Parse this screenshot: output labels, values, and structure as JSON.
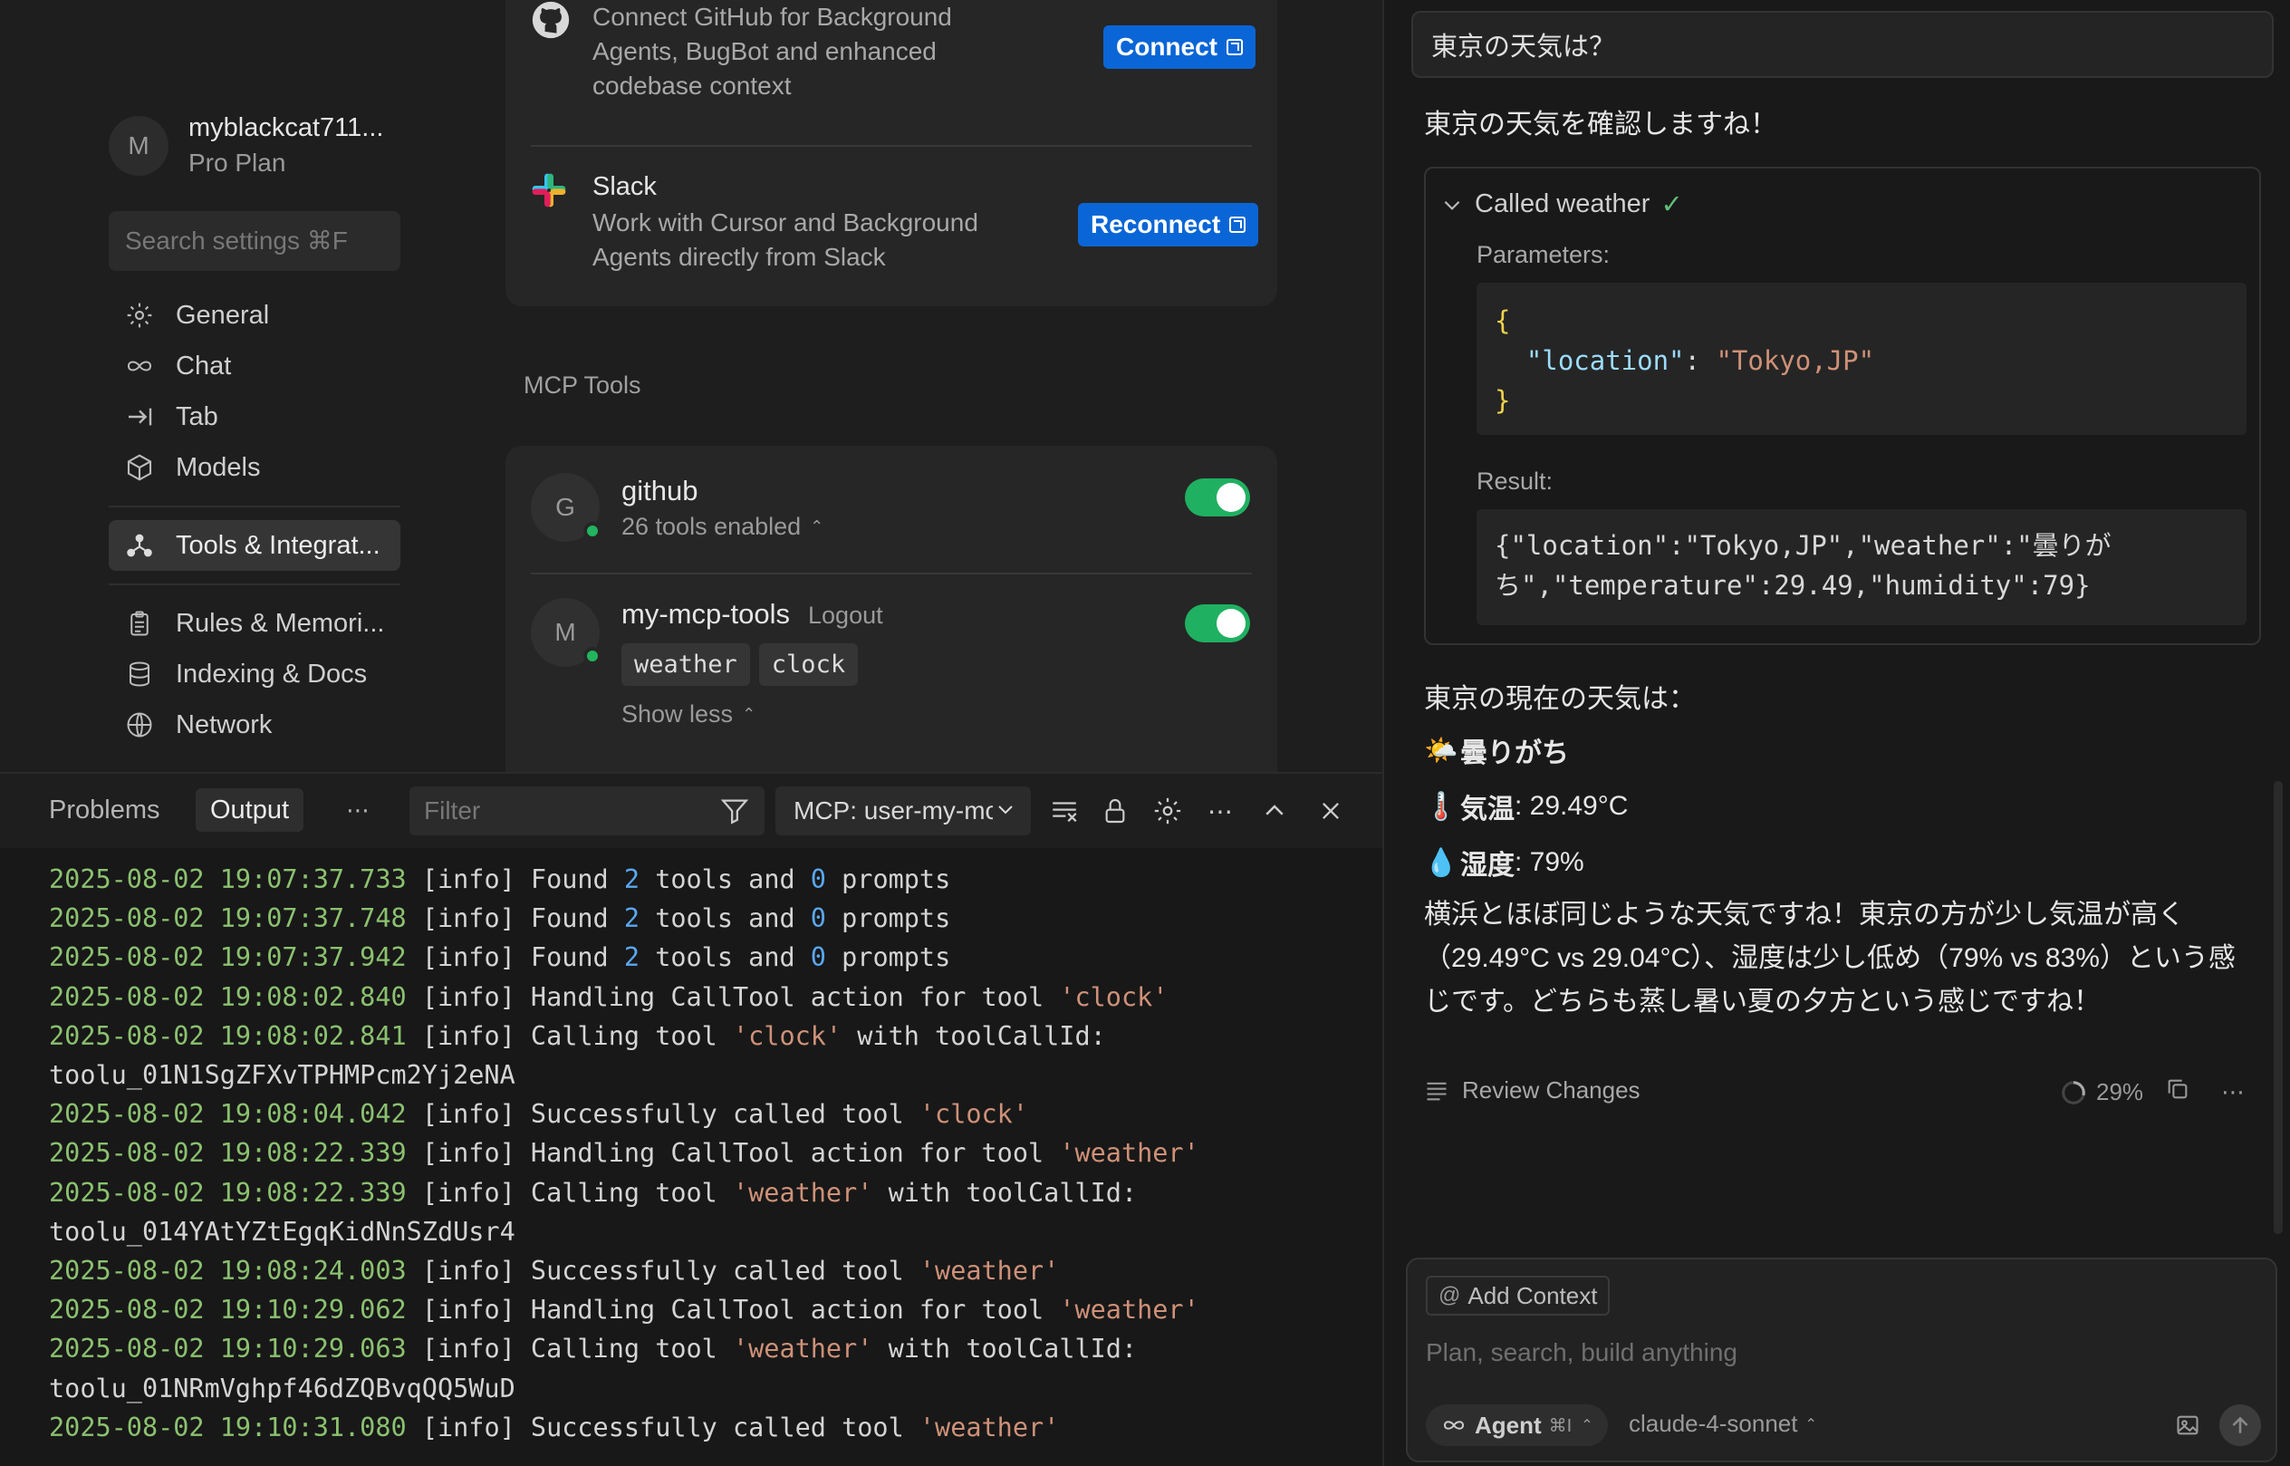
{
  "settings": {
    "account": {
      "avatar_letter": "M",
      "name": "myblackcat711...",
      "plan": "Pro Plan"
    },
    "search_placeholder": "Search settings ⌘F",
    "nav": [
      {
        "label": "General",
        "icon": "gear-icon"
      },
      {
        "label": "Chat",
        "icon": "infinity-icon"
      },
      {
        "label": "Tab",
        "icon": "tab-arrow-icon"
      },
      {
        "label": "Models",
        "icon": "cube-icon"
      },
      {
        "label": "Tools & Integrat...",
        "icon": "tools-icon",
        "active": true
      },
      {
        "label": "Rules & Memori...",
        "icon": "clipboard-icon"
      },
      {
        "label": "Indexing & Docs",
        "icon": "database-icon"
      },
      {
        "label": "Network",
        "icon": "globe-icon"
      }
    ],
    "integrations": [
      {
        "name": "GitHub",
        "desc_lines": [
          "Connect GitHub for Background",
          "Agents, BugBot and enhanced",
          "codebase context"
        ],
        "button": "Connect"
      },
      {
        "name": "Slack",
        "desc_lines": [
          "Work with Cursor and Background",
          "Agents directly from Slack"
        ],
        "button": "Reconnect"
      }
    ],
    "mcp_section_label": "MCP Tools",
    "mcp_servers": [
      {
        "avatar_letter": "G",
        "name": "github",
        "status": "26 tools enabled",
        "enabled": true
      },
      {
        "avatar_letter": "M",
        "name": "my-mcp-tools",
        "logout": "Logout",
        "tools": [
          "weather",
          "clock"
        ],
        "toggle_text": "Show less",
        "enabled": true
      }
    ]
  },
  "panel": {
    "tabs": [
      "Problems",
      "Output"
    ],
    "active_tab": "Output",
    "filter_placeholder": "Filter",
    "channel": "MCP: user-my-mcp-tools",
    "log": [
      {
        "ts": "2025-08-02 19:07:37.733",
        "pre": " [info] Found ",
        "n1": "2",
        "mid": " tools and ",
        "n2": "0",
        "post": " prompts"
      },
      {
        "ts": "2025-08-02 19:07:37.748",
        "pre": " [info] Found ",
        "n1": "2",
        "mid": " tools and ",
        "n2": "0",
        "post": " prompts"
      },
      {
        "ts": "2025-08-02 19:07:37.942",
        "pre": " [info] Found ",
        "n1": "2",
        "mid": " tools and ",
        "n2": "0",
        "post": " prompts"
      },
      {
        "ts": "2025-08-02 19:08:02.840",
        "pre": " [info] Handling CallTool action for tool ",
        "s": "'clock'",
        "post": ""
      },
      {
        "ts": "2025-08-02 19:08:02.841",
        "pre": " [info] Calling tool ",
        "s": "'clock'",
        "post": " with toolCallId:"
      },
      {
        "plain": "toolu_01N1SgZFXvTPHMPcm2Yj2eNA"
      },
      {
        "ts": "2025-08-02 19:08:04.042",
        "pre": " [info] Successfully called tool ",
        "s": "'clock'",
        "post": ""
      },
      {
        "ts": "2025-08-02 19:08:22.339",
        "pre": " [info] Handling CallTool action for tool ",
        "s": "'weather'",
        "post": ""
      },
      {
        "ts": "2025-08-02 19:08:22.339",
        "pre": " [info] Calling tool ",
        "s": "'weather'",
        "post": " with toolCallId:"
      },
      {
        "plain": "toolu_014YAtYZtEgqKidNnSZdUsr4"
      },
      {
        "ts": "2025-08-02 19:08:24.003",
        "pre": " [info] Successfully called tool ",
        "s": "'weather'",
        "post": ""
      },
      {
        "ts": "2025-08-02 19:10:29.062",
        "pre": " [info] Handling CallTool action for tool ",
        "s": "'weather'",
        "post": ""
      },
      {
        "ts": "2025-08-02 19:10:29.063",
        "pre": " [info] Calling tool ",
        "s": "'weather'",
        "post": " with toolCallId:"
      },
      {
        "plain": "toolu_01NRmVghpf46dZQBvqQQ5WuD"
      },
      {
        "ts": "2025-08-02 19:10:31.080",
        "pre": " [info] Successfully called tool ",
        "s": "'weather'",
        "post": ""
      }
    ]
  },
  "chat": {
    "user_message": "東京の天気は？",
    "intro": "東京の天気を確認しますね！",
    "tool_call": {
      "title": "Called weather",
      "params_label": "Parameters:",
      "param_key": "\"location\"",
      "param_value": "\"Tokyo,JP\"",
      "result_label": "Result:",
      "result_lines": [
        "{\"location\":\"Tokyo,JP\",\"weather\":\"曇りが",
        "ち\",\"temperature\":29.49,\"humidity\":79}"
      ]
    },
    "current_label": "東京の現在の天気は：",
    "weather": {
      "emoji": "🌤️",
      "desc": "曇りがち"
    },
    "temp": {
      "emoji": "🌡️",
      "label": "気温",
      "value": ": 29.49°C"
    },
    "humid": {
      "emoji": "💧",
      "label": "湿度",
      "value": ": 79%"
    },
    "summary": "横浜とほぼ同じような天気ですね！東京の方が少し気温が高く（29.49°C vs 29.04°C）、湿度は少し低め（79% vs 83%）という感じです。どちらも蒸し暑い夏の夕方という感じですね！",
    "review_label": "Review Changes",
    "progress_label": "29%",
    "composer": {
      "add_context": "Add Context",
      "placeholder": "Plan, search, build anything",
      "agent_label": "Agent",
      "agent_shortcut": "⌘I",
      "model": "claude-4-sonnet"
    }
  }
}
